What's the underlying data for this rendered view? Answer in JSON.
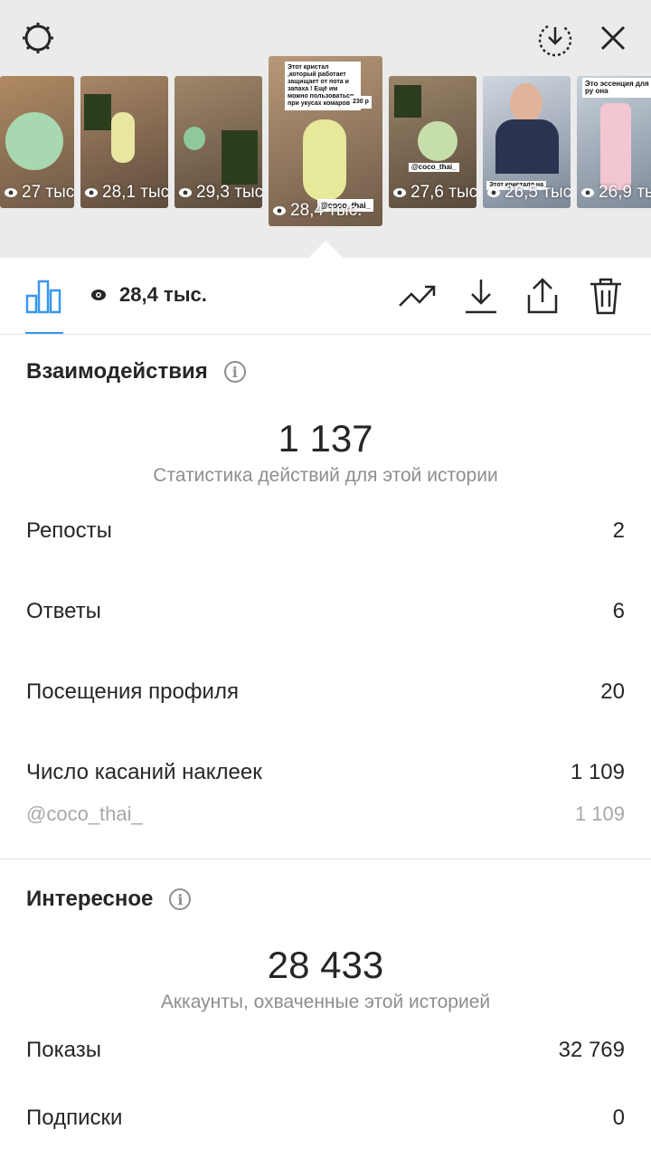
{
  "header": {
    "settings_icon": "gear-icon",
    "download_icon": "download-circle-icon",
    "close_icon": "close-icon"
  },
  "stories": [
    {
      "views": "27 тыс.",
      "caption": ""
    },
    {
      "views": "28,1 тыс.",
      "caption": ""
    },
    {
      "views": "29,3 тыс.",
      "caption": ""
    },
    {
      "views": "28,4 тыс.",
      "caption": "Этот кристал ,который работает защищает от пота и запаха ! Ещё им можно пользоваться при укусах комаров",
      "price": "230 р",
      "tag": "@coco_thai_"
    },
    {
      "views": "27,6 тыс.",
      "caption": "",
      "tag": "@coco_thai_"
    },
    {
      "views": "26,5 тыс.",
      "caption": "Этот кристалл на"
    },
    {
      "views": "26,9 тыс.",
      "caption": "Это эссенция для ру она"
    }
  ],
  "toolbar": {
    "views": "28,4 тыс.",
    "chart_icon": "bar-chart-icon",
    "eye_icon": "eye-icon",
    "promote_icon": "trending-up-icon",
    "save_icon": "download-icon",
    "share_icon": "share-icon",
    "delete_icon": "trash-icon"
  },
  "interactions": {
    "title": "Взаимодействия",
    "total": "1 137",
    "subtitle": "Статистика действий для этой истории",
    "rows": [
      {
        "label": "Репосты",
        "value": "2"
      },
      {
        "label": "Ответы",
        "value": "6"
      },
      {
        "label": "Посещения профиля",
        "value": "20"
      },
      {
        "label": "Число касаний наклеек",
        "value": "1 109"
      }
    ],
    "sticker": {
      "label": "@coco_thai_",
      "value": "1 109"
    }
  },
  "discovery": {
    "title": "Интересное",
    "total": "28 433",
    "subtitle": "Аккаунты, охваченные этой историей",
    "rows": [
      {
        "label": "Показы",
        "value": "32 769"
      },
      {
        "label": "Подписки",
        "value": "0"
      }
    ]
  },
  "colors": {
    "accent": "#3897f0",
    "muted": "#8e8e8e",
    "top_bg": "#ebebeb"
  }
}
